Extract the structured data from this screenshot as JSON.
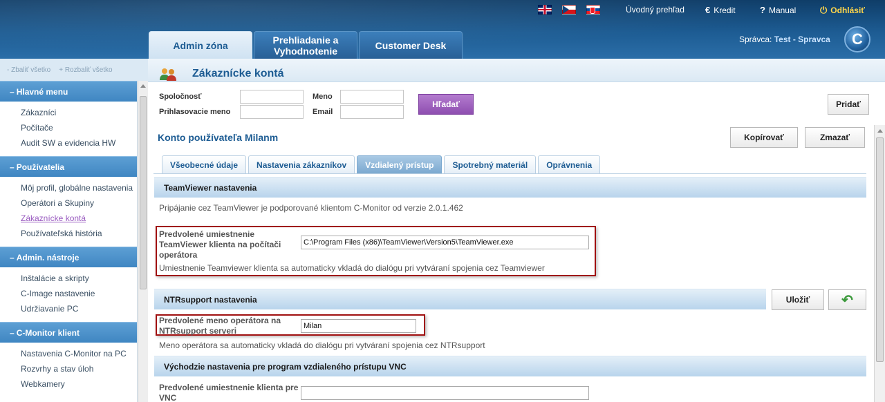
{
  "header": {
    "flags": [
      "en-flag",
      "cz-flag",
      "sk-flag"
    ],
    "links": {
      "overview": "Úvodný prehľad",
      "credit": "Kredit",
      "manual": "Manual",
      "logout": "Odhlásiť"
    },
    "tabs": [
      "Admin zóna",
      "Prehliadanie a Vyhodnotenie",
      "Customer Desk"
    ],
    "admin_label": "Správca:",
    "admin_name": "Test - Spravca",
    "logo_letter": "C"
  },
  "sidebar": {
    "collapse_all": "- Zbaliť všetko",
    "expand_all": "+ Rozbaliť všetko",
    "sections": [
      {
        "title": "Hlavné menu",
        "items": [
          "Zákazníci",
          "Počítače",
          "Audit SW a evidencia HW"
        ]
      },
      {
        "title": "Používatelia",
        "items": [
          "Môj profil, globálne nastavenia",
          "Operátori a Skupiny",
          "Zákaznícke kontá",
          "Používateľská história"
        ]
      },
      {
        "title": "Admin. nástroje",
        "items": [
          "Inštalácie a skripty",
          "C-Image nastavenie",
          "Udržiavanie PC"
        ]
      },
      {
        "title": "C-Monitor klient",
        "items": [
          "Nastavenia C-Monitor na PC",
          "Rozvrhy a stav úloh",
          "Webkamery"
        ]
      }
    ]
  },
  "page": {
    "title": "Zákaznícke kontá",
    "search": {
      "company_label": "Spoločnosť",
      "name_label": "Meno",
      "login_label": "Prihlasovacie meno",
      "email_label": "Email",
      "search_button": "Hľadať",
      "add_button": "Pridať"
    },
    "account_title": "Konto používateľa Milanm",
    "copy_button": "Kopírovať",
    "delete_button": "Zmazať",
    "subtabs": [
      "Všeobecné údaje",
      "Nastavenia zákazníkov",
      "Vzdialený prístup",
      "Spotrebný materiál",
      "Oprávnenia"
    ],
    "teamviewer": {
      "heading": "TeamViewer nastavenia",
      "note": "Pripájanie cez TeamViewer je podporované klientom C-Monitor od verzie 2.0.1.462",
      "field_label": "Predvolené umiestnenie TeamViewer klienta na počítači operátora",
      "field_value": "C:\\Program Files (x86)\\TeamViewer\\Version5\\TeamViewer.exe",
      "hint": "Umiestnenie Teamviewer klienta sa automaticky vkladá do dialógu pri vytváraní spojenia cez Teamviewer"
    },
    "ntr": {
      "heading": "NTRsupport nastavenia",
      "save_button": "Uložiť",
      "field_label": "Predvolené meno operátora na NTRsupport serveri",
      "field_value": "Milan",
      "hint": "Meno operátora sa automaticky vkladá do dialógu pri vytváraní spojenia cez NTRsupport"
    },
    "vnc": {
      "heading": "Východzie nastavenia pre program vzdialeného prístupu VNC",
      "field_label": "Predvolené umiestnenie klienta pre VNC",
      "field_value": ""
    }
  }
}
